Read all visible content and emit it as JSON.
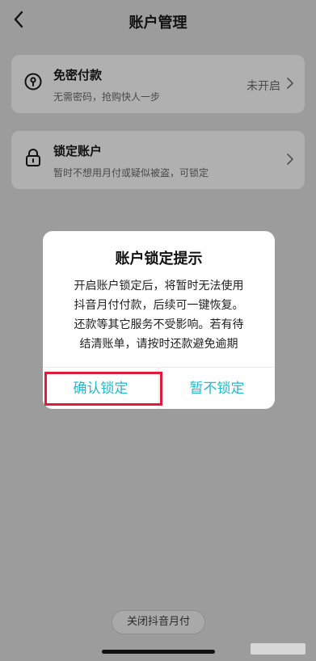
{
  "header": {
    "title": "账户管理"
  },
  "rows": [
    {
      "title": "免密付款",
      "subtitle": "无需密码，抢购快人一步",
      "status": "未开启",
      "icon": "key-lock-icon"
    },
    {
      "title": "锁定账户",
      "subtitle": "暂时不想用月付或疑似被盗，可锁定",
      "icon": "padlock-icon"
    }
  ],
  "modal": {
    "title": "账户锁定提示",
    "body_lines": [
      "开启账户锁定后，将暂时无法使用",
      "抖音月付付款，后续可一键恢复。",
      "还款等其它服务不受影响。若有待",
      "结清账单，请按时还款避免逾期"
    ],
    "confirm_label": "确认锁定",
    "cancel_label": "暂不锁定"
  },
  "footer": {
    "close_label": "关闭抖音月付"
  },
  "colors": {
    "overlay_bg": "#9c9c9c",
    "card_bg": "#b0b0b0",
    "accent": "#24b8c9",
    "highlight": "#e01b3c"
  }
}
